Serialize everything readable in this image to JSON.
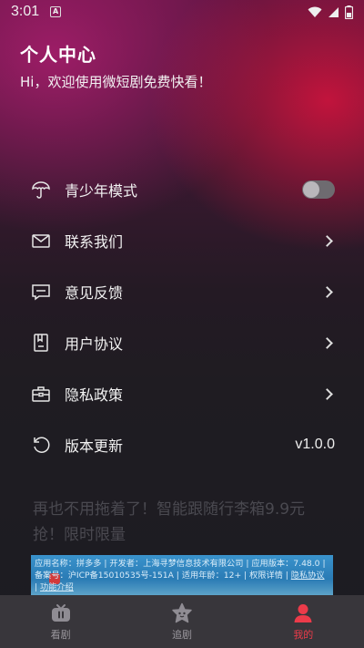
{
  "status_bar": {
    "time": "3:01",
    "notification_glyph": "A"
  },
  "header": {
    "title": "个人中心",
    "subtitle": "Hi，欢迎使用微短剧免费快看！"
  },
  "menu": {
    "items": [
      {
        "label": "青少年模式",
        "icon": "umbrella-icon",
        "right": "toggle",
        "toggle_on": false
      },
      {
        "label": "联系我们",
        "icon": "mail-icon",
        "right": "chevron"
      },
      {
        "label": "意见反馈",
        "icon": "feedback-icon",
        "right": "chevron"
      },
      {
        "label": "用户协议",
        "icon": "agreement-icon",
        "right": "chevron"
      },
      {
        "label": "隐私政策",
        "icon": "privacy-icon",
        "right": "chevron"
      },
      {
        "label": "版本更新",
        "icon": "refresh-icon",
        "right": "text",
        "value": "v1.0.0"
      }
    ]
  },
  "promo": {
    "text": "再也不用拖着了！智能跟随行李箱9.9元抢！限时限量"
  },
  "ad": {
    "line1": "应用名称：拼多多 | 开发者：上海寻梦信息技术有限公司 | 应用版本：7.48.0 | 备案号：沪ICP备15010535号-151A | 适用年龄：12+ | 权限详情 | ",
    "privacy_link": "隐私协议",
    "separator": " | ",
    "feature_link": "功能介绍"
  },
  "tabbar": {
    "tabs": [
      {
        "label": "看剧",
        "icon": "tv-icon",
        "active": false
      },
      {
        "label": "追剧",
        "icon": "star-face-icon",
        "active": false
      },
      {
        "label": "我的",
        "icon": "person-icon",
        "active": true
      }
    ]
  },
  "colors": {
    "accent": "#ec3b4a",
    "tabbar_bg": "#38363b",
    "ad_bg": "#2a7bb5"
  }
}
